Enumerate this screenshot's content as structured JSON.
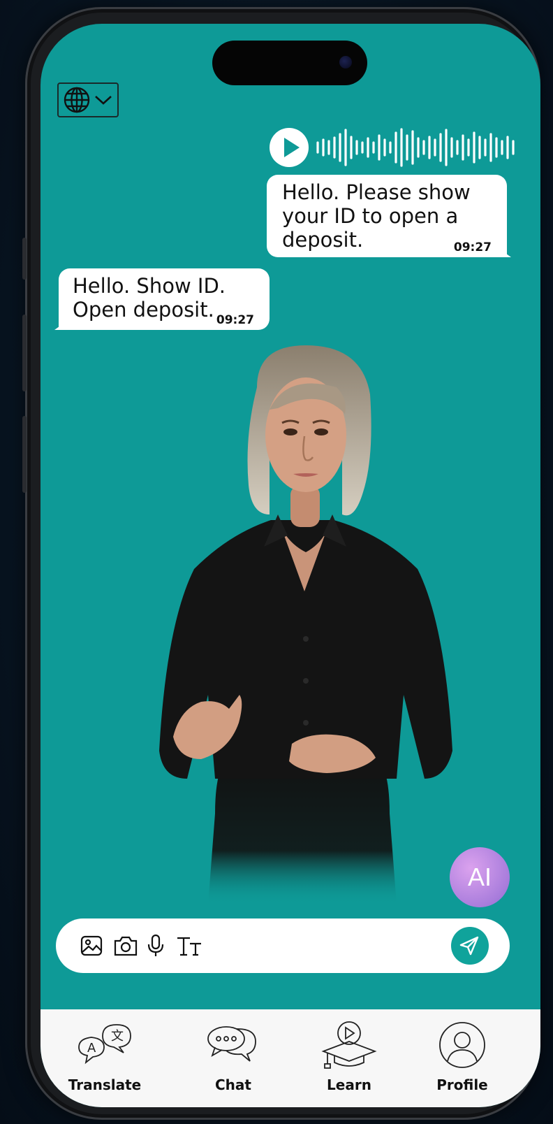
{
  "messages": {
    "outgoing": {
      "text": "Hello. Please show\nyour ID to open a\ndeposit.",
      "time": "09:27"
    },
    "incoming": {
      "text": "Hello. Show ID.\nOpen deposit.",
      "time": "09:27"
    }
  },
  "ai_button": {
    "label": "AI"
  },
  "tabs": [
    {
      "label": "Translate"
    },
    {
      "label": "Chat"
    },
    {
      "label": "Learn"
    },
    {
      "label": "Profile"
    }
  ],
  "colors": {
    "background": "#0e9a97",
    "send": "#10a39b",
    "ai_gradient": "#b98be3"
  },
  "icons": [
    "globe-icon",
    "chevron-down-icon",
    "play-icon",
    "waveform-icon",
    "image-icon",
    "camera-icon",
    "microphone-icon",
    "text-size-icon",
    "send-icon",
    "translate-icon",
    "chat-icon",
    "learn-icon",
    "profile-icon"
  ]
}
